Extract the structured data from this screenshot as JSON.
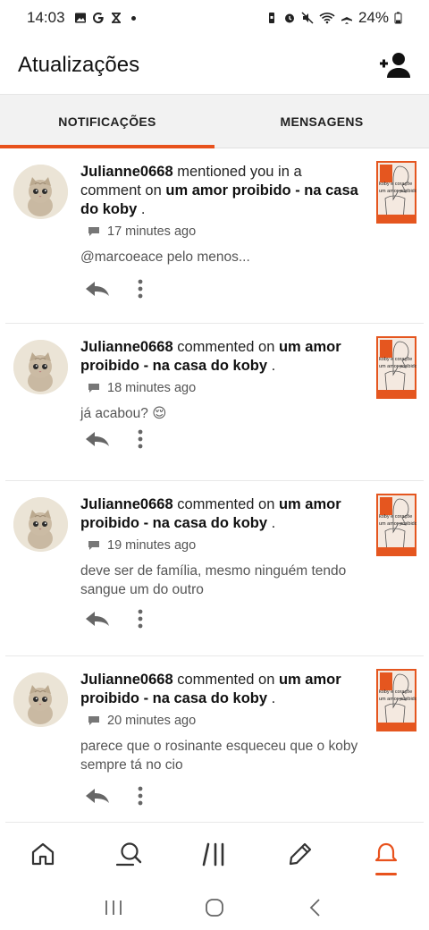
{
  "status_bar": {
    "time": "14:03",
    "left_icons": [
      "image-icon",
      "google-icon",
      "crossed-box-icon"
    ],
    "right_icons": [
      "battery-saver-icon",
      "alarm-icon",
      "mute-icon",
      "wifi-icon",
      "airplane-icon"
    ],
    "battery": "24%"
  },
  "header": {
    "title": "Atualizações",
    "add_user_icon": "add-user-icon"
  },
  "tabs": [
    {
      "label": "NOTIFICAÇÕES",
      "active": true
    },
    {
      "label": "MENSAGENS",
      "active": false
    }
  ],
  "notifications": [
    {
      "user": "Julianne0668",
      "action": " mentioned you in a comment on ",
      "story": "um amor proibido - na casa do koby",
      "end": " .",
      "time": "17 minutes ago",
      "text": "@marcoeace pelo menos..."
    },
    {
      "user": "Julianne0668",
      "action": " commented on ",
      "story": "um amor proibido - na casa do koby",
      "end": " .",
      "time": "18 minutes ago",
      "text": "já acabou? 😌"
    },
    {
      "user": "Julianne0668",
      "action": " commented on ",
      "story": "um amor proibido - na casa do koby",
      "end": " .",
      "time": "19 minutes ago",
      "text": "deve ser de família, mesmo ninguém tendo sangue um do outro"
    },
    {
      "user": "Julianne0668",
      "action": " commented on ",
      "story": "um amor proibido - na casa do koby",
      "end": " .",
      "time": "20 minutes ago",
      "text": "parece que o rosinante esqueceu que o koby sempre tá no cio"
    }
  ],
  "thumbnail_text": {
    "line1": "koby e coraçõe",
    "line2": "um amor proibido"
  },
  "bottom_nav": [
    "home-icon",
    "search-icon",
    "library-icon",
    "write-icon",
    "notifications-icon"
  ],
  "active_nav": "notifications-icon",
  "colors": {
    "accent": "#e8521d",
    "thumb": "#e5561f"
  }
}
